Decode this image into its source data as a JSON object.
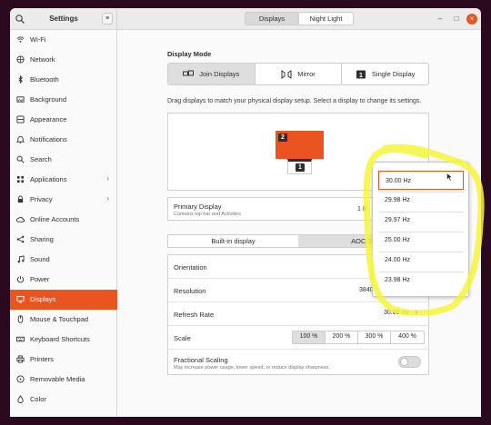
{
  "app": {
    "title": "Settings"
  },
  "header": {
    "tabs": [
      {
        "label": "Displays"
      },
      {
        "label": "Night Light"
      }
    ]
  },
  "sidebar": {
    "items": [
      {
        "label": "Wi-Fi",
        "icon": "wifi-icon"
      },
      {
        "label": "Network",
        "icon": "network-icon"
      },
      {
        "label": "Bluetooth",
        "icon": "bluetooth-icon"
      },
      {
        "label": "Background",
        "icon": "background-icon"
      },
      {
        "label": "Appearance",
        "icon": "appearance-icon"
      },
      {
        "label": "Notifications",
        "icon": "bell-icon"
      },
      {
        "label": "Search",
        "icon": "search-icon"
      },
      {
        "label": "Applications",
        "icon": "apps-icon"
      },
      {
        "label": "Privacy",
        "icon": "privacy-icon"
      },
      {
        "label": "Online Accounts",
        "icon": "cloud-icon"
      },
      {
        "label": "Sharing",
        "icon": "share-icon"
      },
      {
        "label": "Sound",
        "icon": "music-icon"
      },
      {
        "label": "Power",
        "icon": "power-icon"
      },
      {
        "label": "Displays",
        "icon": "display-icon"
      },
      {
        "label": "Mouse & Touchpad",
        "icon": "mouse-icon"
      },
      {
        "label": "Keyboard Shortcuts",
        "icon": "keyboard-icon"
      },
      {
        "label": "Printers",
        "icon": "printer-icon"
      },
      {
        "label": "Removable Media",
        "icon": "media-icon"
      },
      {
        "label": "Color",
        "icon": "color-icon"
      }
    ]
  },
  "main": {
    "display_mode": {
      "title": "Display Mode",
      "options": [
        {
          "label": "Join Displays",
          "icon": "join-displays-icon"
        },
        {
          "label": "Mirror",
          "icon": "mirror-icon"
        },
        {
          "label": "Single Display",
          "icon": "single-display-icon"
        }
      ]
    },
    "arrangement": {
      "hint": "Drag displays to match your physical display setup. Select a display to change its settings.",
      "monitors": [
        {
          "number": "2"
        },
        {
          "number": "1"
        }
      ]
    },
    "primary_display": {
      "title": "Primary Display",
      "subtitle": "Contains top bar and Activities",
      "value": "1 B"
    },
    "display_tabs": [
      {
        "label": "Built-in display"
      },
      {
        "label": "AOC 31"
      }
    ],
    "settings": {
      "orientation_label": "Orientation",
      "resolution_label": "Resolution",
      "resolution_value": "3840",
      "refresh_rate_label": "Refresh Rate",
      "refresh_rate_value": "30.00 Hz",
      "scale_label": "Scale",
      "scale_options": [
        "100 %",
        "200 %",
        "300 %",
        "400 %"
      ],
      "fractional_label": "Fractional Scaling",
      "fractional_sub": "May increase power usage, lower speed, or reduce display sharpness."
    }
  },
  "refresh_popover": {
    "options": [
      "30.00 Hz",
      "29.98 Hz",
      "29.97 Hz",
      "25.00 Hz",
      "24.00 Hz",
      "23.98 Hz"
    ],
    "selected_index": 0
  },
  "colors": {
    "accent": "#e95420",
    "highlight": "#f5f53a"
  }
}
